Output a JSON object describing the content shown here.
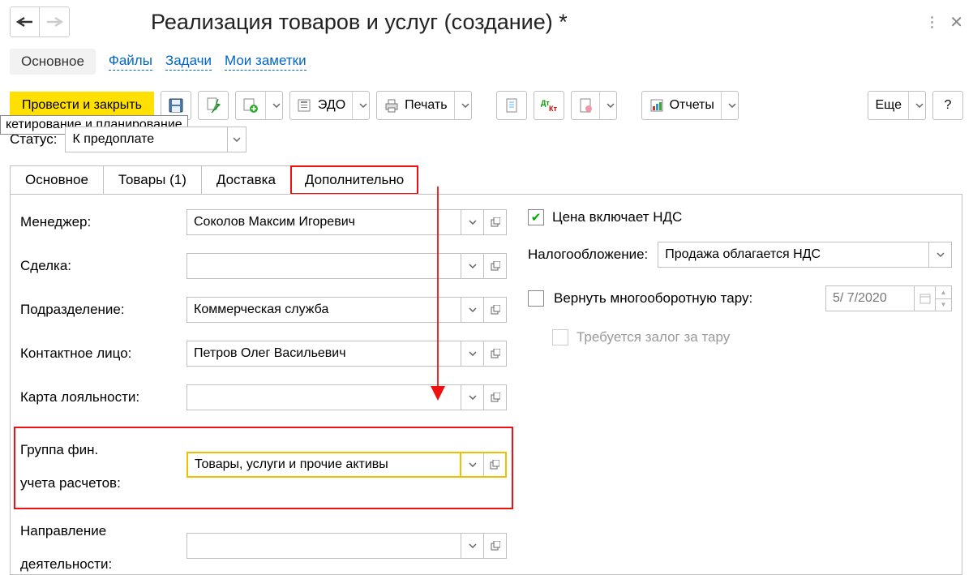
{
  "header": {
    "title": "Реализация товаров и услуг (создание) *"
  },
  "nav": {
    "primary": "Основное",
    "links": [
      "Файлы",
      "Задачи",
      "Мои заметки"
    ]
  },
  "toolbar": {
    "main_btn": "Провести и закрыть",
    "tooltip": "кетирование и планирование",
    "edo": "ЭДО",
    "print": "Печать",
    "reports": "Отчеты",
    "more": "Еще",
    "help": "?"
  },
  "status": {
    "label": "Статус:",
    "value": "К предоплате"
  },
  "tabs": [
    "Основное",
    "Товары (1)",
    "Доставка",
    "Дополнительно"
  ],
  "form": {
    "manager_label": "Менеджер:",
    "manager_value": "Соколов Максим Игоревич",
    "deal_label": "Сделка:",
    "deal_value": "",
    "dept_label": "Подразделение:",
    "dept_value": "Коммерческая служба",
    "contact_label": "Контактное лицо:",
    "contact_value": "Петров Олег Васильевич",
    "loyalty_label": "Карта лояльности:",
    "loyalty_value": "",
    "fingroup_label1": "Группа фин.",
    "fingroup_label2": "учета расчетов:",
    "fingroup_value": "Товары, услуги и прочие активы",
    "direction_label1": "Направление",
    "direction_label2": "деятельности:",
    "direction_value": ""
  },
  "right": {
    "price_incl_nds": "Цена включает НДС",
    "tax_label": "Налогообложение:",
    "tax_value": "Продажа облагается НДС",
    "return_turn": "Вернуть многооборотную тару:",
    "date_value": "5/ 7/2020",
    "deposit_required": "Требуется залог за тару"
  }
}
